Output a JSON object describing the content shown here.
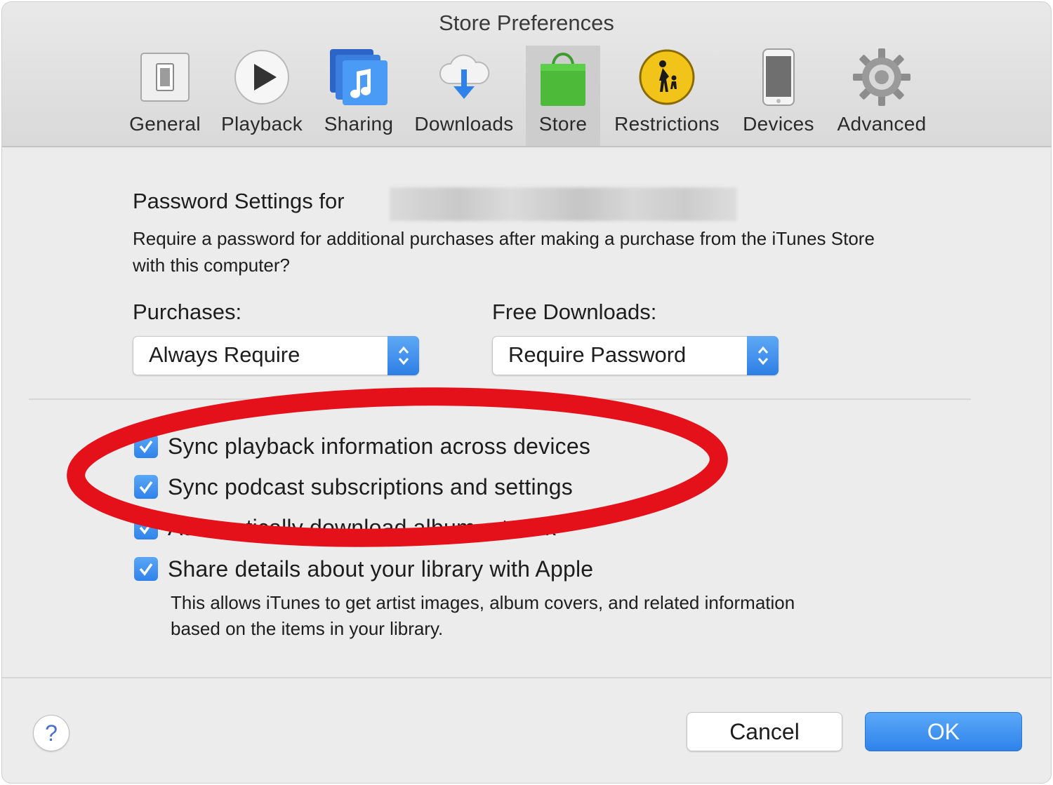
{
  "window": {
    "title": "Store Preferences"
  },
  "toolbar": {
    "items": [
      {
        "label": "General",
        "icon": "general-switch-icon",
        "selected": false
      },
      {
        "label": "Playback",
        "icon": "play-icon",
        "selected": false
      },
      {
        "label": "Sharing",
        "icon": "music-note-icon",
        "selected": false
      },
      {
        "label": "Downloads",
        "icon": "cloud-download-icon",
        "selected": false
      },
      {
        "label": "Store",
        "icon": "shopping-bag-icon",
        "selected": true
      },
      {
        "label": "Restrictions",
        "icon": "parental-icon",
        "selected": false
      },
      {
        "label": "Devices",
        "icon": "phone-icon",
        "selected": false
      },
      {
        "label": "Advanced",
        "icon": "gear-icon",
        "selected": false
      }
    ]
  },
  "password": {
    "title": "Password Settings for",
    "description": "Require a password for additional purchases after making a purchase from the iTunes Store with this computer?"
  },
  "purchases": {
    "label": "Purchases:",
    "value": "Always Require"
  },
  "free_downloads": {
    "label": "Free Downloads:",
    "value": "Require Password"
  },
  "options": [
    {
      "label": "Sync playback information across devices",
      "checked": true
    },
    {
      "label": "Sync podcast subscriptions and settings",
      "checked": true
    },
    {
      "label": "Automatically download album artwork",
      "checked": true
    },
    {
      "label": "Share details about your library with Apple",
      "checked": true
    }
  ],
  "share_description": "This allows iTunes to get artist images, album covers, and related information based on the items in your library.",
  "footer": {
    "help_label": "?",
    "cancel_label": "Cancel",
    "ok_label": "OK"
  },
  "colors": {
    "accent": "#2f82ea",
    "annotation": "#e4111b",
    "selected_tab": "#cdcdcd"
  }
}
